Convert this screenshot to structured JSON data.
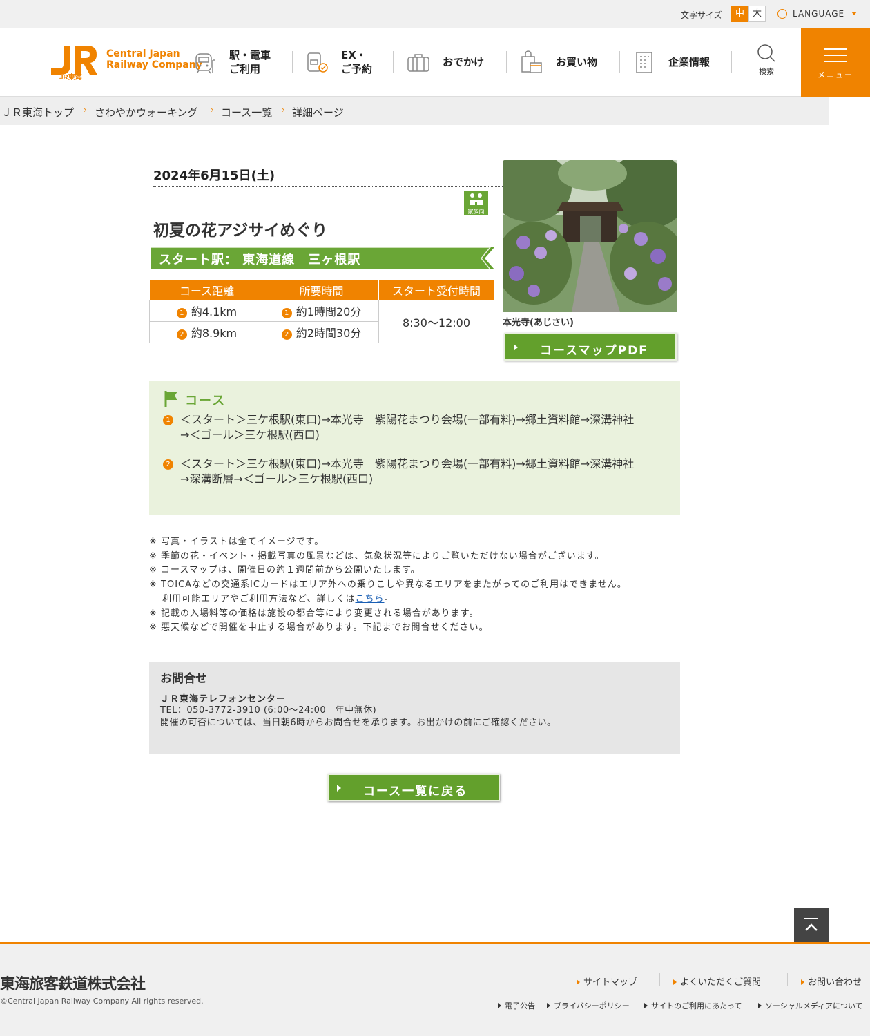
{
  "topbar": {
    "font_size_label": "文字サイズ",
    "font_mid": "中",
    "font_big": "大",
    "language": "LANGUAGE"
  },
  "header": {
    "logo_sub": "JR東海",
    "logo_text_1": "Central Japan",
    "logo_text_2": "Railway Company",
    "nav": [
      {
        "line1": "駅・電車",
        "line2": "ご利用",
        "icon": "train-icon"
      },
      {
        "line1": "EX・",
        "line2": "ご予約",
        "icon": "ticket-icon"
      },
      {
        "line1": "おでかけ",
        "line2": "",
        "icon": "suitcase-icon"
      },
      {
        "line1": "お買い物",
        "line2": "",
        "icon": "shopping-bag-icon"
      },
      {
        "line1": "企業情報",
        "line2": "",
        "icon": "building-icon"
      }
    ],
    "search_label": "検索",
    "menu_label": "メニュー"
  },
  "breadcrumb": [
    "ＪＲ東海トップ",
    "さわやかウォーキング",
    "コース一覧",
    "詳細ページ"
  ],
  "event": {
    "date": "2024年6月15日(土)",
    "family_badge": "家族向",
    "title": "初夏の花アジサイめぐり",
    "start_station": "スタート駅： 東海道線　三ヶ根駅",
    "table_headers": [
      "コース距離",
      "所要時間",
      "スタート受付時間"
    ],
    "rows": [
      {
        "num": "1",
        "distance": "約4.1km",
        "time": "約1時間20分"
      },
      {
        "num": "2",
        "distance": "約8.9km",
        "time": "約2時間30分"
      }
    ],
    "reception": "8:30～12:00",
    "photo_caption": "本光寺(あじさい)",
    "pdf_button": "コースマップPDF"
  },
  "course": {
    "title": "コース",
    "routes": [
      {
        "num": "1",
        "line1": "＜スタート＞三ケ根駅(東口)→本光寺　紫陽花まつり会場(一部有料)→郷土資料館→深溝神社",
        "line2": "→＜ゴール＞三ケ根駅(西口)"
      },
      {
        "num": "2",
        "line1": "＜スタート＞三ケ根駅(東口)→本光寺　紫陽花まつり会場(一部有料)→郷土資料館→深溝神社",
        "line2": "→深溝断層→＜ゴール＞三ケ根駅(西口)"
      }
    ]
  },
  "notes": {
    "n1": "※ 写真・イラストは全てイメージです。",
    "n2": "※ 季節の花・イベント・掲載写真の風景などは、気象状況等によりご覧いただけない場合がございます。",
    "n3": "※ コースマップは、開催日の約１週間前から公開いたします。",
    "n4": "※ TOICAなどの交通系ICカードはエリア外への乗りこしや異なるエリアをまたがってのご利用はできません。",
    "n5_pre": "　 利用可能エリアやご利用方法など、詳しくは",
    "n5_link": "こちら",
    "n5_post": "。",
    "n6": "※ 記載の入場料等の価格は施設の都合等により変更される場合があります。",
    "n7": "※ 悪天候などで開催を中止する場合があります。下記までお問合せください。"
  },
  "contact": {
    "heading": "お問合せ",
    "center": "ＪＲ東海テレフォンセンター",
    "tel": "TEL：050-3772-3910 (6:00～24:00　年中無休)",
    "note": "開催の可否については、当日朝6時からお問合せを承ります。お出かけの前にご確認ください。"
  },
  "back_button": "コース一覧に戻る",
  "footer": {
    "company": "東海旅客鉄道株式会社",
    "copyright": "©Central Japan Railway Company All rights reserved.",
    "links": [
      "サイトマップ",
      "よくいただくご質問",
      "お問い合わせ"
    ],
    "small_links": [
      "電子公告",
      "プライバシーポリシー",
      "サイトのご利用にあたって",
      "ソーシャルメディアについて"
    ]
  },
  "colors": {
    "brand": "#f08300",
    "green": "#63a02c",
    "course_bg": "#eaf2dd"
  }
}
